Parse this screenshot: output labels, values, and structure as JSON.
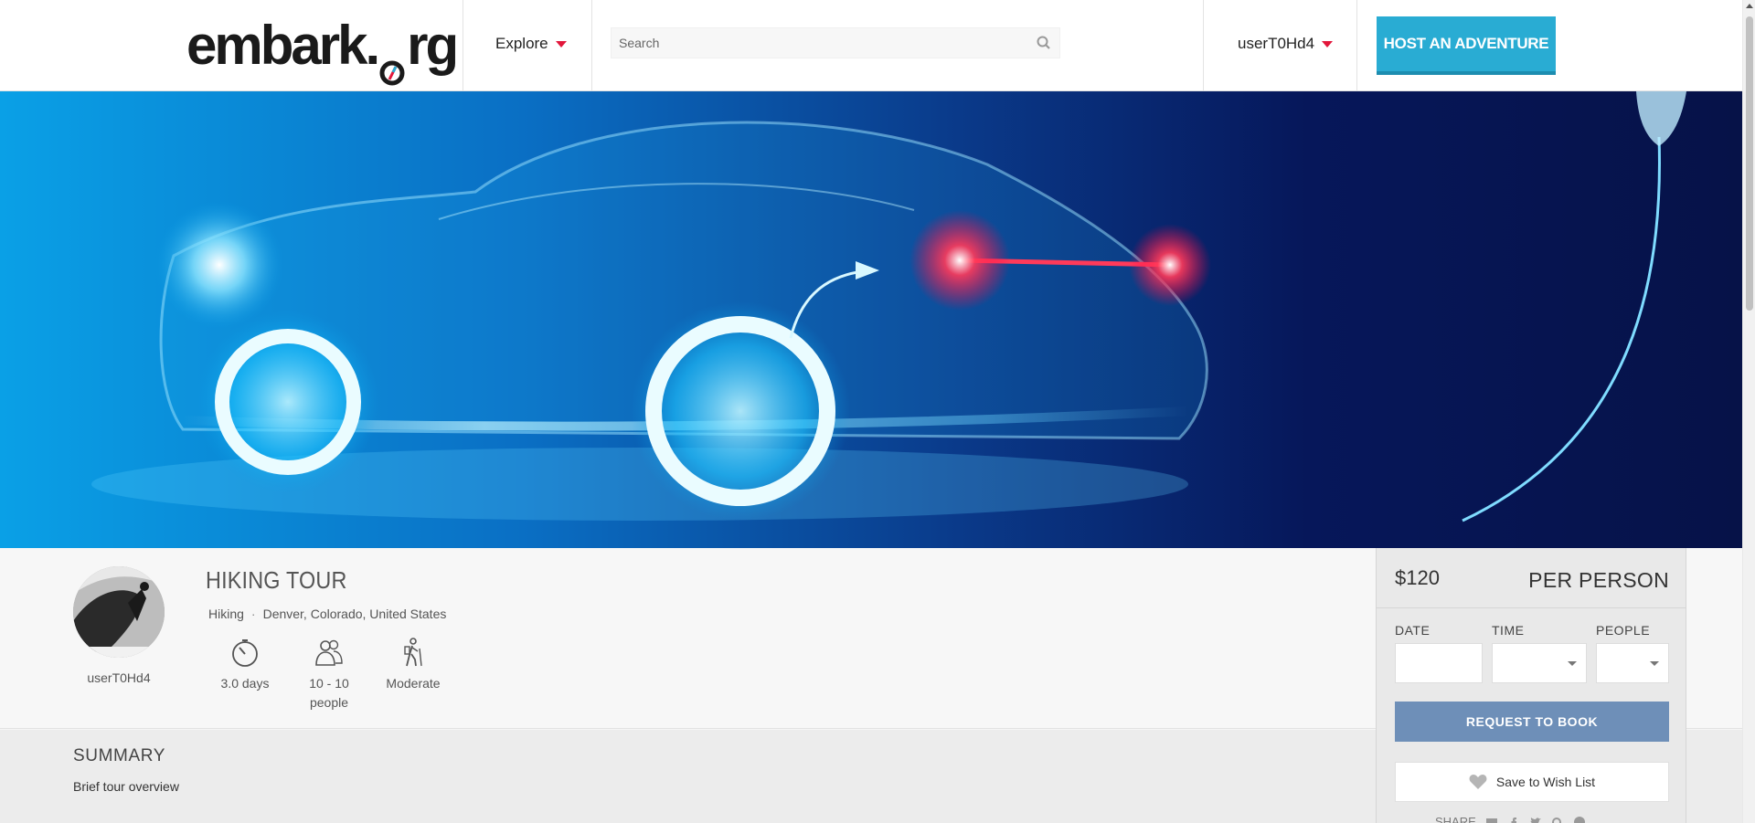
{
  "header": {
    "logo_text": "embark",
    "logo_suffix": "rg",
    "explore_label": "Explore",
    "search_placeholder": "Search",
    "username": "userT0Hd4",
    "host_button": "HOST AN ADVENTURE"
  },
  "colors": {
    "accent": "#e2173b",
    "host_button": "#29acd3",
    "request_button": "#6e8fb8"
  },
  "tour": {
    "title": "HIKING TOUR",
    "category": "Hiking",
    "location": "Denver, Colorado, United States",
    "host": "userT0Hd4",
    "stats": [
      {
        "icon": "stopwatch-icon",
        "label": "3.0 days"
      },
      {
        "icon": "people-icon",
        "label": "10 - 10 people"
      },
      {
        "icon": "hiker-icon",
        "label": "Moderate"
      }
    ]
  },
  "summary": {
    "heading": "SUMMARY",
    "text": "Brief tour overview"
  },
  "booking": {
    "price": "$120",
    "per_label": "PER PERSON",
    "date_label": "DATE",
    "time_label": "TIME",
    "people_label": "PEOPLE",
    "request_button": "REQUEST TO BOOK",
    "wish_button": "Save to Wish List",
    "share_label": "SHARE"
  },
  "hero": {
    "image_icon": "electric-car-illustration"
  }
}
